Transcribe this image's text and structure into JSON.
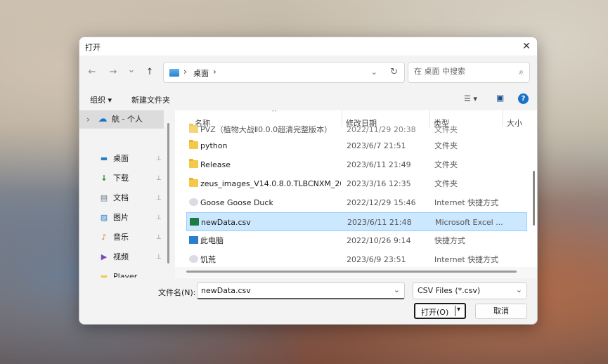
{
  "dialog": {
    "title": "打开",
    "close_glyph": "✕"
  },
  "nav": {
    "back_glyph": "←",
    "forward_glyph": "→",
    "recent_glyph": "⌄",
    "up_glyph": "↑"
  },
  "address": {
    "crumb": "桌面",
    "sep1": "›",
    "sep2": "›",
    "dropdown_glyph": "⌄",
    "refresh_glyph": "↻"
  },
  "search": {
    "placeholder": "在 桌面 中搜索",
    "icon_glyph": "⌕"
  },
  "toolbar": {
    "organize": "组织 ▾",
    "new_folder": "新建文件夹",
    "view_glyph": "☰ ▾",
    "pane_glyph": "▣",
    "help_glyph": "?"
  },
  "sidebar": {
    "items": [
      {
        "label": "航 - 个人",
        "icon": "cloud-icon",
        "glyph": "☁",
        "color": "#1a73c7",
        "pinned": false,
        "expand": "›"
      },
      {
        "label": "桌面",
        "icon": "desktop-icon",
        "glyph": "▬",
        "color": "#2a7fcb",
        "pinned": true
      },
      {
        "label": "下载",
        "icon": "download-icon",
        "glyph": "↓",
        "color": "#1f8a3a",
        "pinned": true
      },
      {
        "label": "文档",
        "icon": "document-icon",
        "glyph": "▤",
        "color": "#6a7a8a",
        "pinned": true
      },
      {
        "label": "图片",
        "icon": "picture-icon",
        "glyph": "▨",
        "color": "#2a7fcb",
        "pinned": true
      },
      {
        "label": "音乐",
        "icon": "music-icon",
        "glyph": "♪",
        "color": "#e0684b",
        "pinned": true
      },
      {
        "label": "视频",
        "icon": "video-icon",
        "glyph": "▶",
        "color": "#7a4ab8",
        "pinned": true
      },
      {
        "label": "Player",
        "icon": "folder-icon",
        "glyph": "▬",
        "color": "#f4c84a",
        "pinned": false
      }
    ],
    "pin_glyph": "📌"
  },
  "columns": {
    "name": "名称",
    "modified": "修改日期",
    "type": "类型",
    "size": "大小",
    "sort_glyph": "^"
  },
  "files": [
    {
      "name": "PVZ（植物大战Ⅱ0.0.0超清完整版本）",
      "date": "2022/11/29 20:38",
      "type": "文件夹",
      "kind": "folder",
      "selected": false
    },
    {
      "name": "python",
      "date": "2023/6/7 21:51",
      "type": "文件夹",
      "kind": "folder",
      "selected": false
    },
    {
      "name": "Release",
      "date": "2023/6/11 21:49",
      "type": "文件夹",
      "kind": "folder",
      "selected": false
    },
    {
      "name": "zeus_images_V14.0.8.0.TLBCNXM_20...",
      "date": "2023/3/16 12:35",
      "type": "文件夹",
      "kind": "folder",
      "selected": false
    },
    {
      "name": "Goose Goose Duck",
      "date": "2022/12/29 15:46",
      "type": "Internet 快捷方式",
      "kind": "shortcut",
      "selected": false
    },
    {
      "name": "newData.csv",
      "date": "2023/6/11 21:48",
      "type": "Microsoft Excel ...",
      "kind": "excel",
      "selected": true
    },
    {
      "name": "此电脑",
      "date": "2022/10/26 9:14",
      "type": "快捷方式",
      "kind": "pc",
      "selected": false
    },
    {
      "name": "饥荒",
      "date": "2023/6/9 23:51",
      "type": "Internet 快捷方式",
      "kind": "shortcut",
      "selected": false
    }
  ],
  "bottom": {
    "filename_label": "文件名(N):",
    "filename_value": "newData.csv",
    "filename_dd": "⌄",
    "filetype_value": "CSV Files (*.csv)",
    "filetype_dd": "⌄",
    "open_label": "打开(O)",
    "open_arrow": "▾",
    "cancel_label": "取消"
  }
}
